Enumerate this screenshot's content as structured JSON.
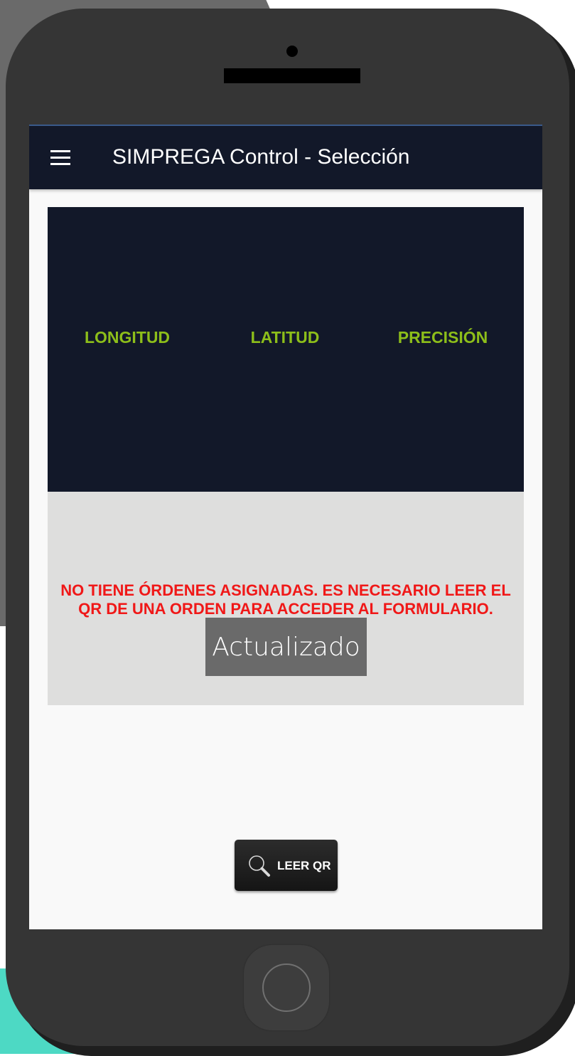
{
  "colors": {
    "appbar": "#121829",
    "coord_label": "#8dbe1a",
    "warning": "#f01818",
    "toast_bg": "#6a6a6a",
    "phone_body": "#353535"
  },
  "appbar": {
    "menu_icon": "hamburger-menu-icon",
    "title": "SIMPREGA Control - Selección"
  },
  "coordinates": {
    "longitude_label": "LONGITUD",
    "latitude_label": "LATITUD",
    "precision_label": "PRECISIÓN"
  },
  "status": {
    "line1": "NO TIENE ÓRDENES ASIGNADAS. ES NECESARIO LEER EL",
    "line2": "QR DE UNA ORDEN PARA ACCEDER AL FORMULARIO."
  },
  "toast": {
    "text": "Actualizado"
  },
  "qr_button": {
    "icon": "search-icon",
    "label": "LEER QR"
  }
}
